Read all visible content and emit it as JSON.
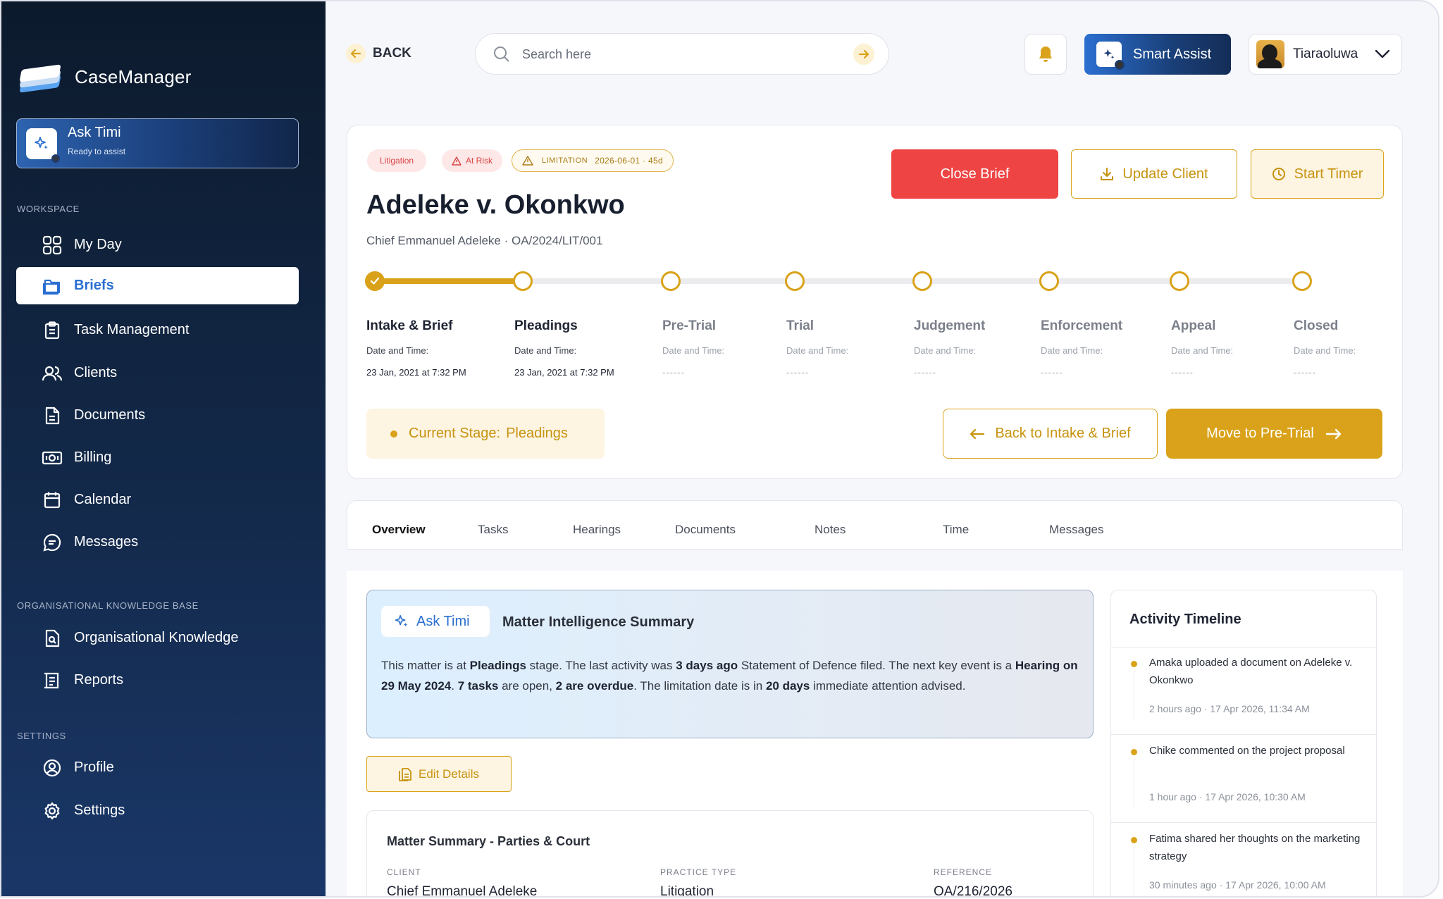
{
  "app": {
    "name": "CaseManager"
  },
  "sidebar": {
    "ask": {
      "title": "Ask Timi",
      "subtitle": "Ready to assist"
    },
    "workspace_label": "WORKSPACE",
    "workspace_items": [
      {
        "label": "My Day",
        "icon": "grid-icon"
      },
      {
        "label": "Briefs",
        "icon": "folder-icon",
        "active": true
      },
      {
        "label": "Task Management",
        "icon": "clipboard-icon"
      },
      {
        "label": "Clients",
        "icon": "users-icon"
      },
      {
        "label": "Documents",
        "icon": "document-icon"
      },
      {
        "label": "Billing",
        "icon": "banknote-icon"
      },
      {
        "label": "Calendar",
        "icon": "calendar-icon"
      },
      {
        "label": "Messages",
        "icon": "message-icon"
      }
    ],
    "knowledge_label": "ORGANISATIONAL KNOWLEDGE BASE",
    "knowledge_items": [
      {
        "label": "Organisational Knowledge",
        "icon": "knowledge-icon"
      },
      {
        "label": "Reports",
        "icon": "report-icon"
      }
    ],
    "settings_label": "SETTINGS",
    "settings_items": [
      {
        "label": "Profile",
        "icon": "profile-icon"
      },
      {
        "label": "Settings",
        "icon": "gear-icon"
      }
    ]
  },
  "topbar": {
    "back_label": "BACK",
    "search_placeholder": "Search here",
    "smart_assist_label": "Smart Assist",
    "user_name": "Tiaraoluwa"
  },
  "brief": {
    "tags": {
      "practice": "Litigation",
      "risk": "At Risk",
      "limitation_label": "LIMITATION",
      "limitation_value": "2026-06-01 · 45d"
    },
    "title": "Adeleke v. Okonkwo",
    "subtitle": "Chief Emmanuel Adeleke · OA/2024/LIT/001",
    "buttons": {
      "close": "Close Brief",
      "update": "Update Client",
      "timer": "Start Timer"
    },
    "progress": {
      "completed_stages": 1,
      "current_stage_index": 1
    },
    "stages": [
      {
        "name": "Intake & Brief",
        "date_label": "Date and Time:",
        "date": "23 Jan, 2021 at 7:32 PM"
      },
      {
        "name": "Pleadings",
        "date_label": "Date and Time:",
        "date": "23 Jan, 2021 at 7:32 PM"
      },
      {
        "name": "Pre-Trial",
        "date_label": "Date and Time:",
        "date": "------"
      },
      {
        "name": "Trial",
        "date_label": "Date and Time:",
        "date": "------"
      },
      {
        "name": "Judgement",
        "date_label": "Date and Time:",
        "date": "------"
      },
      {
        "name": "Enforcement",
        "date_label": "Date and Time:",
        "date": "------"
      },
      {
        "name": "Appeal",
        "date_label": "Date and Time:",
        "date": "------"
      },
      {
        "name": "Closed",
        "date_label": "Date and Time:",
        "date": "------"
      }
    ],
    "current_stage_label": "Current Stage:",
    "current_stage_value": "Pleadings",
    "back_stage_label": "Back to Intake & Brief",
    "move_stage_label": "Move to Pre-Trial"
  },
  "tabs": [
    "Overview",
    "Tasks",
    "Hearings",
    "Documents",
    "Notes",
    "Time",
    "Messages"
  ],
  "summary": {
    "pill_label": "Ask Timi",
    "title": "Matter Intelligence Summary",
    "text": {
      "t1": "This matter is at ",
      "b1": "Pleadings",
      "t2": " stage. The last activity was ",
      "b2": "3 days ago",
      "t3": " Statement of Defence filed. The next key event is a ",
      "b3": "Hearing on 29 May 2024",
      "t4": ". ",
      "b4": "7 tasks",
      "t5": " are open, ",
      "b5": "2 are overdue",
      "t6": ". The limitation date is in ",
      "b6": "20 days",
      "t7": " immediate attention advised."
    }
  },
  "edit_label": "Edit Details",
  "matter_summary": {
    "title": "Matter Summary - Parties & Court",
    "fields": [
      {
        "key": "CLIENT",
        "value": "Chief Emmanuel Adeleke"
      },
      {
        "key": "PRACTICE TYPE",
        "value": "Litigation"
      },
      {
        "key": "REFERENCE",
        "value": "OA/216/2026"
      }
    ]
  },
  "timeline": {
    "title": "Activity Timeline",
    "items": [
      {
        "text": "Amaka uploaded a document on Adeleke v. Okonkwo",
        "time": "2 hours ago · 17 Apr 2026, 11:34 AM"
      },
      {
        "text": "Chike commented on the project proposal",
        "time": "1 hour ago · 17 Apr 2026, 10:30 AM"
      },
      {
        "text": "Fatima shared her thoughts on the marketing strategy",
        "time": "30 minutes ago · 17 Apr 2026, 10:00 AM"
      }
    ]
  },
  "colors": {
    "gold": "#d9a21a",
    "blue": "#2a6fd1",
    "red": "#ef4444",
    "navy": "#0c1a2c"
  }
}
